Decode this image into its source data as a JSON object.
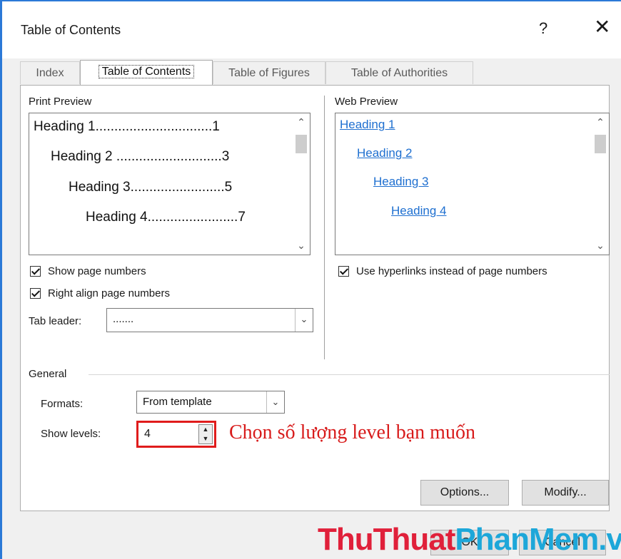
{
  "window": {
    "title": "Table of Contents",
    "help_glyph": "?",
    "close_glyph": "✕"
  },
  "tabs": [
    {
      "label": "Index"
    },
    {
      "label": "Table of Contents"
    },
    {
      "label": "Table of Figures"
    },
    {
      "label": "Table of Authorities"
    }
  ],
  "print_preview": {
    "label": "Print Preview",
    "lines": [
      "Heading 1...............................1",
      "Heading 2 ............................3",
      "Heading 3.........................5",
      "Heading 4........................7"
    ]
  },
  "web_preview": {
    "label": "Web Preview",
    "links": [
      "Heading 1",
      "Heading 2",
      "Heading 3",
      "Heading 4"
    ]
  },
  "options": {
    "show_page_numbers": "Show page numbers",
    "right_align": "Right align page numbers",
    "use_hyperlinks": "Use hyperlinks instead of page numbers",
    "tab_leader_label": "Tab leader:",
    "tab_leader_value": "......."
  },
  "general": {
    "label": "General",
    "formats_label": "Formats:",
    "formats_value": "From template",
    "show_levels_label": "Show levels:",
    "show_levels_value": "4"
  },
  "annotation": "Chọn số lượng level bạn muốn",
  "buttons": {
    "options": "Options...",
    "modify": "Modify...",
    "ok": "OK",
    "cancel": "Cancel"
  },
  "watermark": {
    "part1": "ThuThuat",
    "part2": "PhanMem.vn"
  },
  "colors": {
    "accent": "#2b79d7",
    "link": "#1e6fd0",
    "annotation": "#d81b1b"
  }
}
